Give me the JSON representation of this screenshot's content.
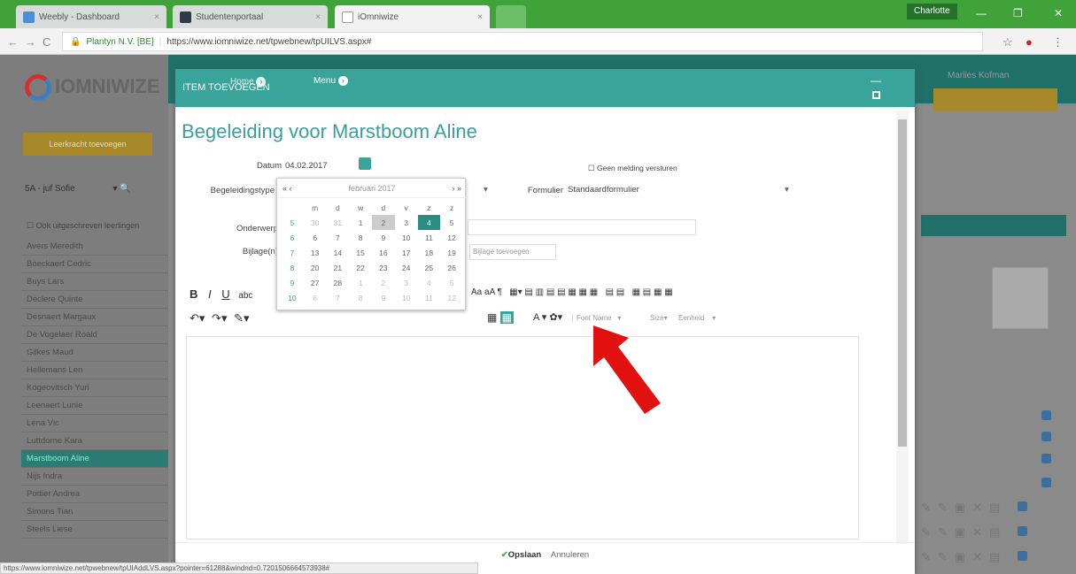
{
  "browser": {
    "tabs": [
      {
        "label": "Weebly - Dashboard",
        "color": "#4a90d9"
      },
      {
        "label": "Studentenportaal",
        "color": "#2e3a4a"
      },
      {
        "label": "iOmniwize",
        "color": "#ffffff"
      }
    ],
    "profile": "Charlotte",
    "site_identity": "Plantyn N.V. [BE]",
    "url": "https://www.iomniwize.net/tpwebnew/tpUILVS.aspx#",
    "status_url": "https://www.iomniwize.net/tpwebnew/tpUIAddLVS.aspx?pointer=61288&windnd=0.7201506664573938#"
  },
  "app": {
    "logo_text": "IOMNIWIZE",
    "left_button": "Leerkracht toevoegen",
    "class_select": "5A - juf Sofie",
    "checkbox_label": "Ook uitgeschreven leerlingen",
    "students": [
      "Avers Meredith",
      "Boeckaert Cedric",
      "Buys Lars",
      "Declere Quinte",
      "Desnaert Margaux",
      "De Vogelaer Roald",
      "Gilkes Maud",
      "Hellemans Len",
      "Kogeovitsch Yuri",
      "Leenaert Lunie",
      "Lena Vic",
      "Luttdorne Kara",
      "Marstboom Aline",
      "Nijs Indra",
      "Pottier Andrea",
      "Simons Tian",
      "Steels Liese"
    ],
    "selected_student": "Marstboom Aline",
    "right_user": "Marlies Kofman",
    "accent": "#3aa49a"
  },
  "modal": {
    "header_title": "ITEM TOEVOEGEN",
    "home_label": "Home",
    "menu_label": "Menu",
    "heading": "Begeleiding voor Marstboom Aline",
    "datum_label": "Datum",
    "datum_value": "04.02.2017",
    "no_notify_label": "Geen melding versturen",
    "type_label": "Begeleidingstype",
    "formulier_label": "Formulier",
    "formulier_value": "Standaardformulier",
    "onderwerp_label": "Onderwerp",
    "bijlagen_label": "Bijlage(n)",
    "bijlage_placeholder": "Bijlage toevoegen",
    "font_name": "Font Name",
    "size": "Size",
    "eenheid": "Eenheid",
    "save_label": "Opslaan",
    "cancel_label": "Annuleren"
  },
  "calendar": {
    "month": "februari 2017",
    "prev_year": "«",
    "prev": "‹",
    "next": "›",
    "next_year": "»",
    "weekdays": [
      "m",
      "d",
      "w",
      "d",
      "v",
      "z",
      "z"
    ],
    "weeks": [
      {
        "wk": "5",
        "days": [
          "30",
          "31",
          "1",
          "2",
          "3",
          "4",
          "5"
        ]
      },
      {
        "wk": "6",
        "days": [
          "6",
          "7",
          "8",
          "9",
          "10",
          "11",
          "12"
        ]
      },
      {
        "wk": "7",
        "days": [
          "13",
          "14",
          "15",
          "16",
          "17",
          "18",
          "19"
        ]
      },
      {
        "wk": "8",
        "days": [
          "20",
          "21",
          "22",
          "23",
          "24",
          "25",
          "26"
        ]
      },
      {
        "wk": "9",
        "days": [
          "27",
          "28",
          "1",
          "2",
          "3",
          "4",
          "5"
        ]
      },
      {
        "wk": "10",
        "days": [
          "6",
          "7",
          "8",
          "9",
          "10",
          "11",
          "12"
        ]
      }
    ],
    "today": "2",
    "selected": "4"
  }
}
